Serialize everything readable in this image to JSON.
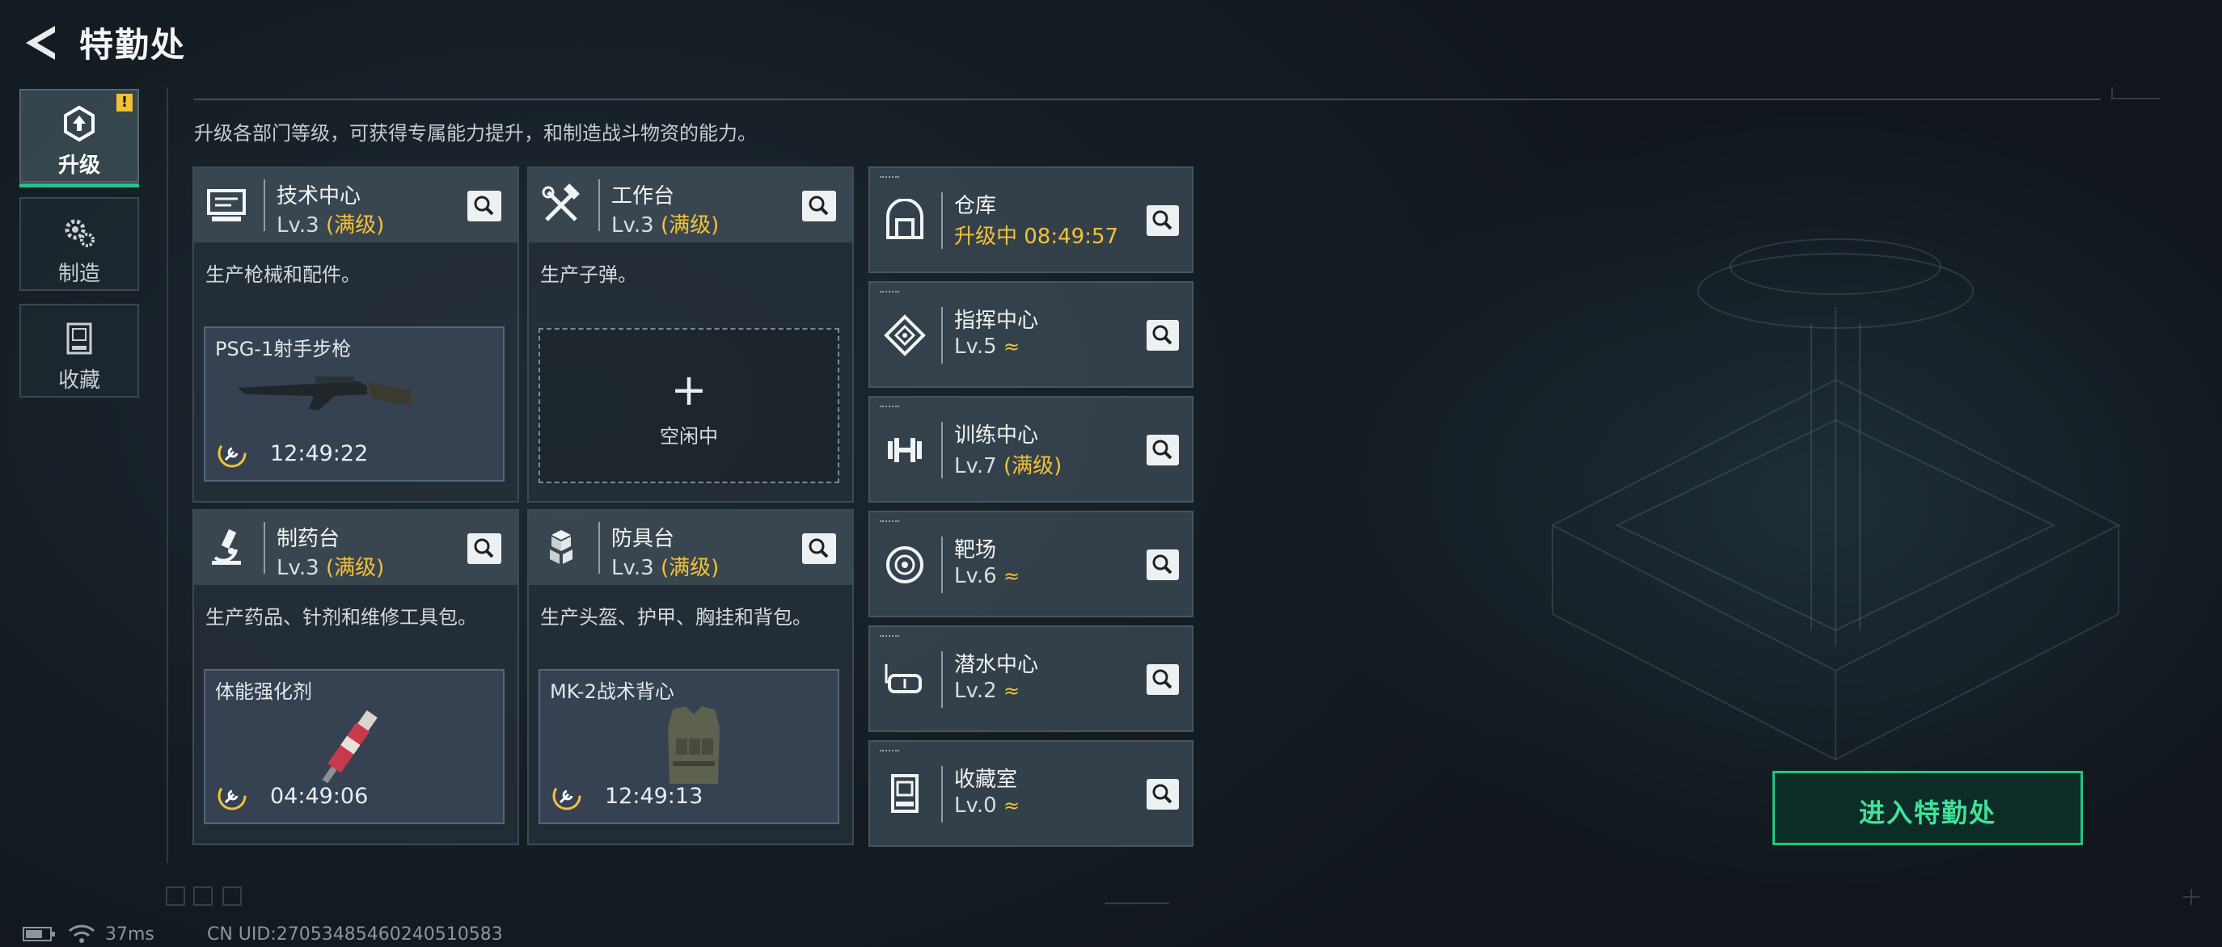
{
  "header": {
    "title": "特勤处"
  },
  "tabs": [
    {
      "label": "升级",
      "active": true,
      "alert": "!"
    },
    {
      "label": "制造",
      "active": false
    },
    {
      "label": "收藏",
      "active": false
    }
  ],
  "description": "升级各部门等级，可获得专属能力提升，和制造战斗物资的能力。",
  "stations": [
    {
      "name": "技术中心",
      "level": "Lv.3",
      "max_label": "(满级)",
      "desc": "生产枪械和配件。",
      "slot": {
        "item": "PSG-1射手步枪",
        "time": "12:49:22"
      }
    },
    {
      "name": "工作台",
      "level": "Lv.3",
      "max_label": "(满级)",
      "desc": "生产子弹。",
      "slot": {
        "plus": "+",
        "idle_label": "空闲中"
      }
    },
    {
      "name": "制药台",
      "level": "Lv.3",
      "max_label": "(满级)",
      "desc": "生产药品、针剂和维修工具包。",
      "slot": {
        "item": "体能强化剂",
        "time": "04:49:06"
      }
    },
    {
      "name": "防具台",
      "level": "Lv.3",
      "max_label": "(满级)",
      "desc": "生产头盔、护甲、胸挂和背包。",
      "slot": {
        "item": "MK-2战术背心",
        "time": "12:49:13"
      }
    }
  ],
  "buildings": [
    {
      "name": "仓库",
      "status": "升级中 08:49:57",
      "icon": "warehouse-icon"
    },
    {
      "name": "指挥中心",
      "level": "Lv.5",
      "up": "≈",
      "icon": "command-icon"
    },
    {
      "name": "训练中心",
      "level": "Lv.7",
      "max_label": "(满级)",
      "icon": "dumbbell-icon"
    },
    {
      "name": "靶场",
      "level": "Lv.6",
      "up": "≈",
      "icon": "target-icon"
    },
    {
      "name": "潜水中心",
      "level": "Lv.2",
      "up": "≈",
      "icon": "diving-mask-icon"
    },
    {
      "name": "收藏室",
      "level": "Lv.0",
      "up": "≈",
      "icon": "collection-icon"
    }
  ],
  "enter_button": "进入特勤处",
  "status_bar": {
    "ping": "37ms",
    "uid": "CN UID:27053485460240510583"
  },
  "colors": {
    "accent": "#22c77f",
    "gold": "#f2c23a"
  }
}
